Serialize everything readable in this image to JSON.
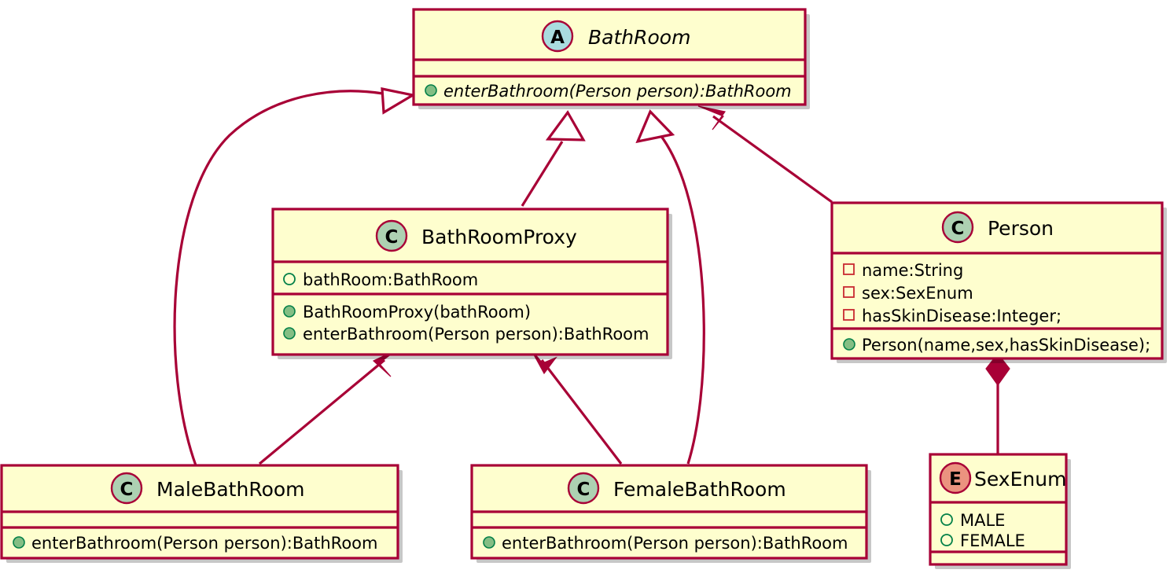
{
  "diagram": {
    "kind": "uml-class-diagram",
    "title": "BathRoom Proxy Pattern Class Diagram",
    "colors": {
      "box_fill": "#FEFECE",
      "border": "#A80036",
      "class_badge": "#ADD1B2",
      "abstract_badge": "#A9DCDF",
      "enum_badge": "#EB937F",
      "public_marker": "#84BE84",
      "private_marker": "#C82930",
      "background": "#FFFFFF"
    }
  },
  "classes": [
    {
      "id": "bathroom",
      "name": "BathRoom",
      "badge": "A",
      "badge_kind": "abstract",
      "italic": true,
      "fields": [],
      "methods": [
        {
          "visibility": "public",
          "marker": "filled-circle",
          "text": "enterBathroom(Person person):BathRoom",
          "italic": true
        }
      ]
    },
    {
      "id": "bathroomproxy",
      "name": "BathRoomProxy",
      "badge": "C",
      "badge_kind": "class",
      "italic": false,
      "fields": [
        {
          "visibility": "public",
          "marker": "hollow-circle",
          "text": "bathRoom:BathRoom"
        }
      ],
      "methods": [
        {
          "visibility": "public",
          "marker": "filled-circle",
          "text": "BathRoomProxy(bathRoom)"
        },
        {
          "visibility": "public",
          "marker": "filled-circle",
          "text": "enterBathroom(Person person):BathRoom"
        }
      ]
    },
    {
      "id": "person",
      "name": "Person",
      "badge": "C",
      "badge_kind": "class",
      "italic": false,
      "fields": [
        {
          "visibility": "private",
          "marker": "square",
          "text": "name:String"
        },
        {
          "visibility": "private",
          "marker": "square",
          "text": "sex:SexEnum"
        },
        {
          "visibility": "private",
          "marker": "square",
          "text": "hasSkinDisease:Integer;"
        }
      ],
      "methods": [
        {
          "visibility": "public",
          "marker": "filled-circle",
          "text": "Person(name,sex,hasSkinDisease);"
        }
      ]
    },
    {
      "id": "malebathroom",
      "name": "MaleBathRoom",
      "badge": "C",
      "badge_kind": "class",
      "italic": false,
      "fields": [],
      "methods": [
        {
          "visibility": "public",
          "marker": "filled-circle",
          "text": "enterBathroom(Person person):BathRoom"
        }
      ]
    },
    {
      "id": "femalebathroom",
      "name": "FemaleBathRoom",
      "badge": "C",
      "badge_kind": "class",
      "italic": false,
      "fields": [],
      "methods": [
        {
          "visibility": "public",
          "marker": "filled-circle",
          "text": "enterBathroom(Person person):BathRoom"
        }
      ]
    },
    {
      "id": "sexenum",
      "name": "SexEnum",
      "badge": "E",
      "badge_kind": "enum",
      "italic": false,
      "fields": [
        {
          "visibility": "public",
          "marker": "hollow-circle",
          "text": "MALE"
        },
        {
          "visibility": "public",
          "marker": "hollow-circle",
          "text": "FEMALE"
        }
      ],
      "methods": []
    }
  ],
  "relations": [
    {
      "id": "rel-male-extends-bathroom",
      "from": "MaleBathRoom",
      "to": "BathRoom",
      "type": "generalization",
      "arrow": "hollow-triangle"
    },
    {
      "id": "rel-proxy-extends-bathroom",
      "from": "BathRoomProxy",
      "to": "BathRoom",
      "type": "generalization",
      "arrow": "hollow-triangle"
    },
    {
      "id": "rel-female-extends-bathroom",
      "from": "FemaleBathRoom",
      "to": "BathRoom",
      "type": "generalization",
      "arrow": "hollow-triangle"
    },
    {
      "id": "rel-person-uses-bathroom",
      "from": "Person",
      "to": "BathRoom",
      "type": "association",
      "arrow": "solid-arrow"
    },
    {
      "id": "rel-male-to-proxy",
      "from": "MaleBathRoom",
      "to": "BathRoomProxy",
      "type": "association",
      "arrow": "solid-arrow"
    },
    {
      "id": "rel-female-to-proxy",
      "from": "FemaleBathRoom",
      "to": "BathRoomProxy",
      "type": "association",
      "arrow": "solid-arrow"
    },
    {
      "id": "rel-person-composes-sexenum",
      "from": "Person",
      "to": "SexEnum",
      "type": "composition",
      "arrow": "filled-diamond"
    }
  ],
  "labels": {
    "bathroom_title": "BathRoom",
    "bathroom_badge": "A",
    "bathroom_method_1": "enterBathroom(Person person):BathRoom",
    "proxy_title": "BathRoomProxy",
    "proxy_badge": "C",
    "proxy_field_1": "bathRoom:BathRoom",
    "proxy_method_1": "BathRoomProxy(bathRoom)",
    "proxy_method_2": "enterBathroom(Person person):BathRoom",
    "person_title": "Person",
    "person_badge": "C",
    "person_field_1": "name:String",
    "person_field_2": "sex:SexEnum",
    "person_field_3": "hasSkinDisease:Integer;",
    "person_method_1": "Person(name,sex,hasSkinDisease);",
    "male_title": "MaleBathRoom",
    "male_badge": "C",
    "male_method_1": "enterBathroom(Person person):BathRoom",
    "female_title": "FemaleBathRoom",
    "female_badge": "C",
    "female_method_1": "enterBathroom(Person person):BathRoom",
    "sexenum_title": "SexEnum",
    "sexenum_badge": "E",
    "sexenum_value_1": "MALE",
    "sexenum_value_2": "FEMALE"
  }
}
